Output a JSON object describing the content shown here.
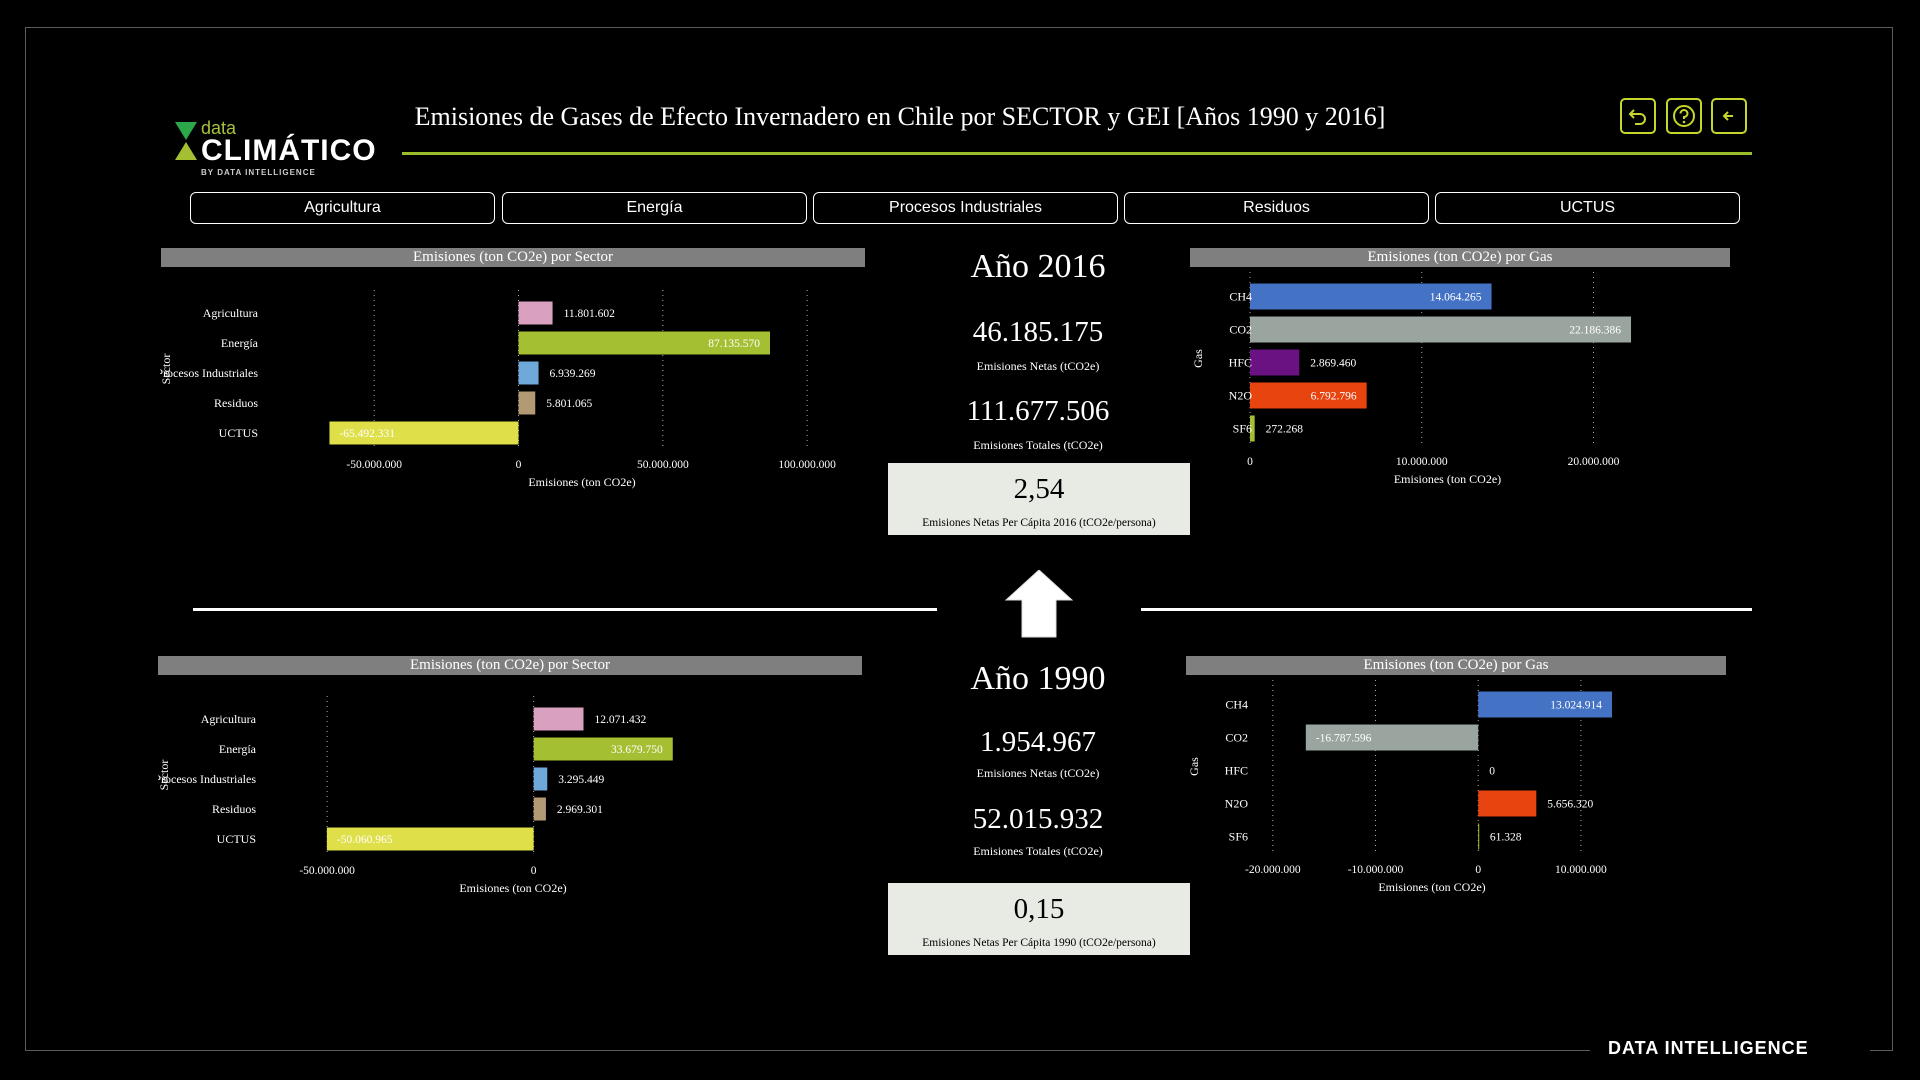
{
  "header": {
    "title": "Emisiones de Gases de Efecto Invernadero en Chile por SECTOR y GEI [Años 1990 y 2016]",
    "logo_small": "data",
    "logo_big": "CLIMÁTICO",
    "logo_by": "BY DATA INTELLIGENCE",
    "icons": [
      "undo-icon",
      "help-icon",
      "back-arrow-icon"
    ]
  },
  "tabs": [
    "Agricultura",
    "Energía",
    "Procesos Industriales",
    "Residuos",
    "UCTUS"
  ],
  "y2016": {
    "year_label": "Año 2016",
    "net": "46.185.175",
    "net_label": "Emisiones Netas (tCO2e)",
    "total": "111.677.506",
    "total_label": "Emisiones Totales (tCO2e)",
    "per_capita": "2,54",
    "per_capita_label": "Emisiones Netas Per Cápita 2016 (tCO2e/persona)"
  },
  "y1990": {
    "year_label": "Año 1990",
    "net": "1.954.967",
    "net_label": "Emisiones Netas (tCO2e)",
    "total": "52.015.932",
    "total_label": "Emisiones Totales (tCO2e)",
    "per_capita": "0,15",
    "per_capita_label": "Emisiones Netas Per Cápita 1990 (tCO2e/persona)"
  },
  "footer": {
    "brand": "DATA INTELLIGENCE"
  },
  "colors": {
    "accent": "#9bbd2a",
    "agricultura": "#d9a0bf",
    "energia": "#a5bf32",
    "procesos": "#6fa9d9",
    "residuos": "#b29a74",
    "uctus": "#dfdf4a",
    "ch4": "#4472c4",
    "co2": "#9aa59f",
    "hfc": "#6a1282",
    "n2o": "#e8440f",
    "sf6": "#a5bf32"
  },
  "chart_data": [
    {
      "id": "sector2016",
      "type": "bar",
      "orientation": "horizontal",
      "title": "Emisiones (ton CO2e) por Sector",
      "xlabel": "Emisiones (ton CO2e)",
      "ylabel": "Sector",
      "categories": [
        "Agricultura",
        "Energía",
        "Procesos Industriales",
        "Residuos",
        "UCTUS"
      ],
      "values": [
        11801602,
        87135570,
        6939269,
        5801065,
        -65492331
      ],
      "value_labels": [
        "11.801.602",
        "87.135.570",
        "6.939.269",
        "5.801.065",
        "-65.492.331"
      ],
      "color_keys": [
        "agricultura",
        "energia",
        "procesos",
        "residuos",
        "uctus"
      ],
      "xlim": [
        -66000000,
        110000000
      ],
      "ticks": [
        -50000000,
        0,
        50000000,
        100000000
      ],
      "tick_labels": [
        "-50.000.000",
        "0",
        "50.000.000",
        "100.000.000"
      ],
      "grid": true
    },
    {
      "id": "gas2016",
      "type": "bar",
      "orientation": "horizontal",
      "title": "Emisiones (ton CO2e) por Gas",
      "xlabel": "Emisiones (ton CO2e)",
      "ylabel": "Gas",
      "categories": [
        "CH4",
        "CO2",
        "HFC",
        "N2O",
        "SF6"
      ],
      "values": [
        14064265,
        22186386,
        2869460,
        6792796,
        272268
      ],
      "value_labels": [
        "14.064.265",
        "22.186.386",
        "2.869.460",
        "6.792.796",
        "272.268"
      ],
      "color_keys": [
        "ch4",
        "co2",
        "hfc",
        "n2o",
        "sf6"
      ],
      "xlim": [
        0,
        23000000
      ],
      "ticks": [
        0,
        10000000,
        20000000
      ],
      "tick_labels": [
        "0",
        "10.000.000",
        "20.000.000"
      ],
      "grid": true
    },
    {
      "id": "sector1990",
      "type": "bar",
      "orientation": "horizontal",
      "title": "Emisiones (ton CO2e) por Sector",
      "xlabel": "Emisiones (ton CO2e)",
      "ylabel": "Sector",
      "categories": [
        "Agricultura",
        "Energía",
        "Procesos Industriales",
        "Residuos",
        "UCTUS"
      ],
      "values": [
        12071432,
        33679750,
        3295449,
        2969301,
        -50060965
      ],
      "value_labels": [
        "12.071.432",
        "33.679.750",
        "3.295.449",
        "2.969.301",
        "-50.060.965"
      ],
      "color_keys": [
        "agricultura",
        "energia",
        "procesos",
        "residuos",
        "uctus"
      ],
      "xlim": [
        -51000000,
        41000000
      ],
      "ticks": [
        -50000000,
        0
      ],
      "tick_labels": [
        "-50.000.000",
        "0"
      ],
      "grid": true
    },
    {
      "id": "gas1990",
      "type": "bar",
      "orientation": "horizontal",
      "title": "Emisiones (ton CO2e) por Gas",
      "xlabel": "Emisiones (ton CO2e)",
      "ylabel": "Gas",
      "categories": [
        "CH4",
        "CO2",
        "HFC",
        "N2O",
        "SF6"
      ],
      "values": [
        13024914,
        -16787596,
        0,
        5656320,
        61328
      ],
      "value_labels": [
        "13.024.914",
        "-16.787.596",
        "0",
        "5.656.320",
        "61.328"
      ],
      "color_keys": [
        "ch4",
        "co2",
        "hfc",
        "n2o",
        "sf6"
      ],
      "xlim": [
        -23000000,
        14000000
      ],
      "ticks": [
        -20000000,
        -10000000,
        0,
        10000000
      ],
      "tick_labels": [
        "-20.000.000",
        "-10.000.000",
        "0",
        "10.000.000"
      ],
      "grid": true
    }
  ]
}
